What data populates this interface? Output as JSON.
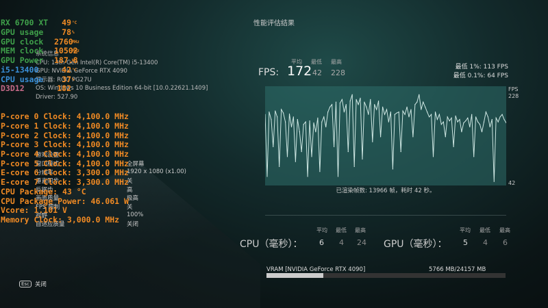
{
  "title": "性能评估结果",
  "osd": [
    {
      "label": "RX 6700 XT",
      "cls": "g",
      "value": "49",
      "unit": "°C"
    },
    {
      "label": "GPU usage",
      "cls": "g",
      "value": "78",
      "unit": "%"
    },
    {
      "label": "GPU clock",
      "cls": "g",
      "value": "2760",
      "unit": "MHz"
    },
    {
      "label": "MEM clock",
      "cls": "g",
      "value": "10502",
      "unit": "MHz"
    },
    {
      "label": "GPU Power",
      "cls": "g",
      "value": "187.8",
      "unit": "W"
    },
    {
      "label": "i5-13400",
      "cls": "b",
      "value": "42",
      "unit": "°C"
    },
    {
      "label": "CPU usage",
      "cls": "b",
      "value": "37",
      "unit": "%"
    },
    {
      "label": "D3D12",
      "cls": "p",
      "value": "182",
      "unit": ""
    }
  ],
  "osd_lines": [
    "P-core 0 Clock: 4,100.0 MHz",
    "P-core 1 Clock: 4,100.0 MHz",
    "P-core 2 Clock: 4,100.0 MHz",
    "P-core 3 Clock: 4,100.0 MHz",
    "P-core 4 Clock: 4,100.0 MHz",
    "P-core 5 Clock: 4,100.0 MHz",
    "E-core 6 Clock: 3,300.0 MHz",
    "E-core 7 Clock: 3,300.0 MHz",
    "CPU Package: 43 °C",
    "CPU Package Power: 46.061 W",
    "Vcore: 1.101 V",
    "Memory Clock: 3,000.0 MHz"
  ],
  "system": {
    "heading": "系统信息",
    "lines": [
      "CPU: 13th Gen Intel(R) Core(TM) i5-13400",
      "GPU: NVIDIA GeForce RTX 4090",
      "显示器: ROG PG27U",
      "OS: Windows 10 Business Edition 64-bit [10.0.22621.1409]",
      "Driver: 527.90"
    ]
  },
  "settings": {
    "heading": "游戏设置",
    "rows": [
      {
        "label": "窗口模式",
        "value": "全屏幕"
      },
      {
        "label": "分辨率",
        "value": "1920 x 1080 (x1.00)"
      },
      {
        "label": "垂直同步",
        "value": "关"
      },
      {
        "label": "反锯齿",
        "value": "高"
      },
      {
        "label": "画面质量",
        "value": "极高"
      },
      {
        "label": "FPS 限制",
        "value": "关"
      },
      {
        "label": "视野",
        "value": "100%"
      },
      {
        "label": "自适应质量",
        "value": "关闭"
      }
    ]
  },
  "fps": {
    "label": "FPS:",
    "avg": "172",
    "min": "42",
    "max": "228",
    "h_avg": "平均",
    "h_min": "最低",
    "h_max": "最高",
    "low1": "最低 1%:  113 FPS",
    "low01": "最低 0.1%:  64 FPS"
  },
  "rendered": "已渲染帧数: 13966 帧，耗时 42 秒。",
  "cpu": {
    "label": "CPU（毫秒）：",
    "avg": "6",
    "min": "4",
    "max": "24"
  },
  "gpu": {
    "label": "GPU（毫秒）：",
    "avg": "5",
    "min": "4",
    "max": "6"
  },
  "vram": {
    "label": "VRAM [NVIDIA GeForce RTX 4090]",
    "value": "5766 MB/24157 MB",
    "fraction": 0.2387
  },
  "esc": {
    "key": "Esc",
    "label": "关闭"
  },
  "chart_data": {
    "type": "line",
    "ylabel": "FPS",
    "ylim": [
      42,
      228
    ],
    "tick_labels": [
      "228",
      "42"
    ],
    "values": [
      185,
      60,
      190,
      175,
      120,
      192,
      180,
      80,
      195,
      188,
      170,
      100,
      186,
      160,
      180,
      90,
      175,
      150,
      110,
      165,
      170,
      60,
      172,
      100,
      168,
      150,
      178,
      70,
      170,
      180,
      160,
      190,
      200,
      205,
      120,
      210,
      60,
      208,
      215,
      190,
      205,
      110,
      212,
      225,
      80,
      215,
      205,
      218,
      95,
      210,
      200,
      185,
      215,
      130,
      205,
      195,
      212,
      140,
      200,
      185,
      195,
      170,
      190,
      75,
      185,
      188,
      190,
      110,
      192,
      185,
      200,
      180,
      195,
      140,
      205,
      210,
      225,
      195,
      210,
      200,
      190,
      180,
      185,
      100,
      190,
      175,
      185,
      165,
      170,
      140,
      180,
      172,
      178,
      120,
      182,
      170,
      175,
      150,
      168,
      172,
      178,
      160,
      185,
      100,
      180,
      170,
      165,
      150,
      170,
      190,
      180,
      160,
      175,
      50,
      178,
      170,
      180,
      185,
      175,
      168
    ]
  }
}
